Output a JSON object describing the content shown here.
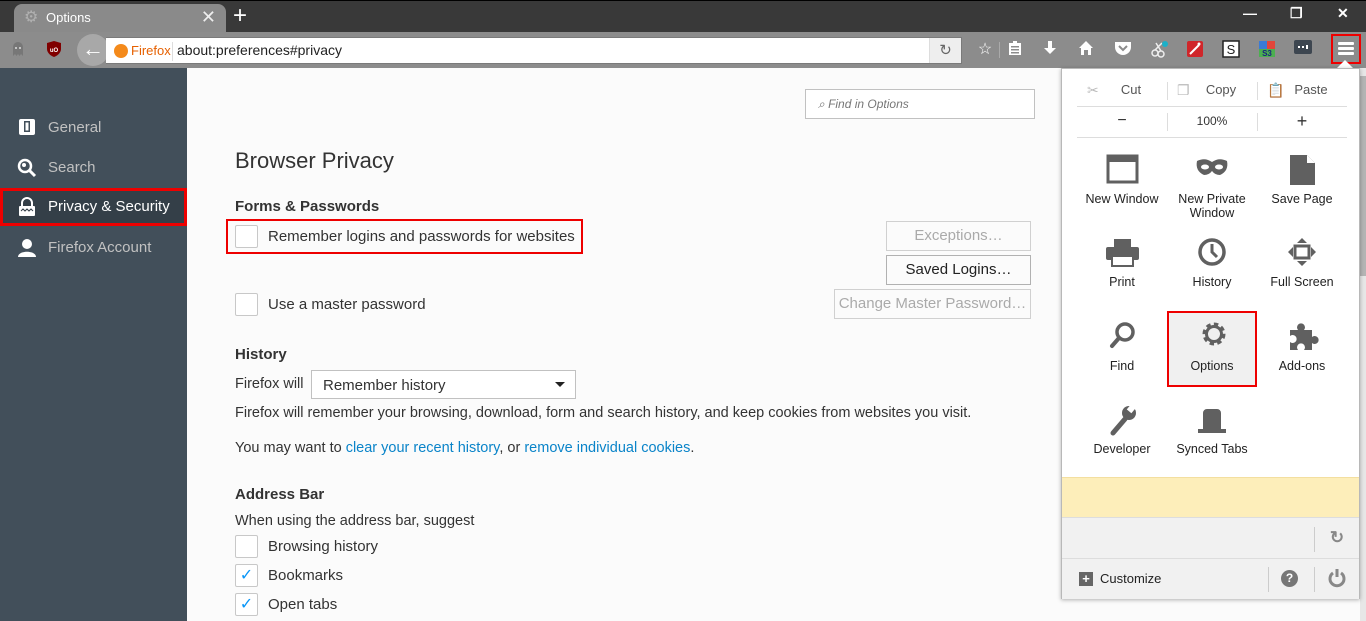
{
  "window": {
    "tab_title": "Options",
    "tab_icon": "gear-icon",
    "minimize": "—",
    "restore": "❐",
    "close": "✕"
  },
  "navbar": {
    "identity_label": "Firefox",
    "url": "about:preferences#privacy",
    "toolbar_icons": [
      "bookmark-star-icon",
      "reading-list-icon",
      "downloads-icon",
      "home-icon",
      "pocket-icon",
      "screenshot-extension-icon",
      "magic-wand-extension-icon",
      "s-extension-icon",
      "s3-extension-icon",
      "more-extension-icon",
      "hamburger-menu-icon"
    ]
  },
  "sidebar": {
    "items": [
      {
        "label": "General",
        "icon": "general-icon"
      },
      {
        "label": "Search",
        "icon": "search-icon"
      },
      {
        "label": "Privacy & Security",
        "icon": "lock-icon",
        "active": true
      },
      {
        "label": "Firefox Account",
        "icon": "account-icon"
      }
    ]
  },
  "main": {
    "find_placeholder": "Find in Options",
    "page_title": "Browser Privacy",
    "forms": {
      "heading": "Forms & Passwords",
      "remember_logins": {
        "label": "Remember logins and passwords for websites",
        "checked": false
      },
      "master_password": {
        "label": "Use a master password",
        "checked": false
      },
      "exceptions_button": "Exceptions…",
      "saved_logins_button": "Saved Logins…",
      "change_master_button": "Change Master Password…"
    },
    "history": {
      "heading": "History",
      "firefox_will_label": "Firefox will",
      "selected_option": "Remember history",
      "description": "Firefox will remember your browsing, download, form and search history, and keep cookies from websites you visit.",
      "hint_prefix": "You may want to ",
      "clear_link": "clear your recent history",
      "hint_middle": ", or ",
      "remove_link": "remove individual cookies",
      "hint_suffix": "."
    },
    "address_bar": {
      "heading": "Address Bar",
      "subheading": "When using the address bar, suggest",
      "options": [
        {
          "label": "Browsing history",
          "checked": false
        },
        {
          "label": "Bookmarks",
          "checked": true
        },
        {
          "label": "Open tabs",
          "checked": true
        }
      ]
    }
  },
  "menu_panel": {
    "cut": "Cut",
    "copy": "Copy",
    "paste": "Paste",
    "zoom_out": "−",
    "zoom_level": "100%",
    "zoom_in": "+",
    "items": [
      {
        "label": "New Window",
        "icon": "new-window-icon"
      },
      {
        "label": "New Private Window",
        "icon": "private-mask-icon"
      },
      {
        "label": "Save Page",
        "icon": "save-page-icon"
      },
      {
        "label": "Print",
        "icon": "print-icon"
      },
      {
        "label": "History",
        "icon": "history-clock-icon"
      },
      {
        "label": "Full Screen",
        "icon": "full-screen-icon"
      },
      {
        "label": "Find",
        "icon": "find-icon"
      },
      {
        "label": "Options",
        "icon": "options-gear-icon",
        "selected": true
      },
      {
        "label": "Add-ons",
        "icon": "addons-puzzle-icon"
      },
      {
        "label": "Developer",
        "icon": "developer-wrench-icon"
      },
      {
        "label": "Synced Tabs",
        "icon": "synced-tabs-icon"
      }
    ],
    "customize": "Customize"
  }
}
